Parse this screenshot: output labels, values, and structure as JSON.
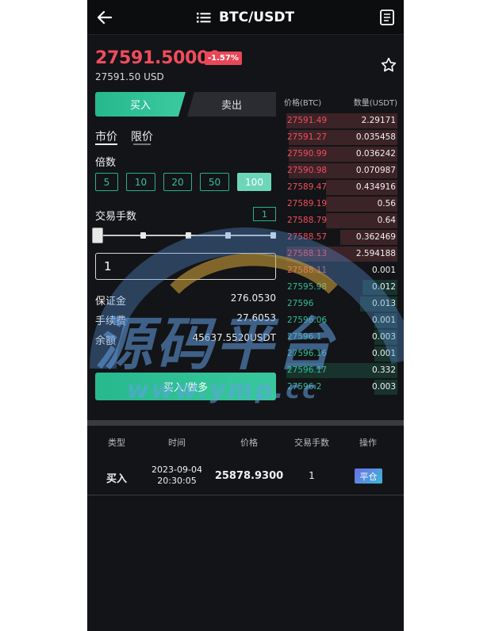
{
  "header": {
    "title": "BTC/USDT"
  },
  "ticker": {
    "price": "27591.50000",
    "change": "-1.57%",
    "usd_price": "27591.50 USD"
  },
  "trade_tabs": {
    "buy": "买入",
    "sell": "卖出"
  },
  "order_types": {
    "market": "市价",
    "limit": "限价"
  },
  "leverage": {
    "label": "倍数",
    "options": [
      "5",
      "10",
      "20",
      "50",
      "100"
    ],
    "selected": "100"
  },
  "quantity": {
    "label": "交易手数",
    "badge": "1",
    "input_value": "1",
    "slider_value_fraction": 0
  },
  "summary": {
    "margin_label": "保证金",
    "margin_value": "276.0530",
    "fee_label": "手续费",
    "fee_value": "27.6053",
    "balance_label": "余额",
    "balance_value": "45637.5520USDT"
  },
  "submit": {
    "label": "买入/做多"
  },
  "orderbook": {
    "price_header": "价格(BTC)",
    "qty_header": "数量(USDT)",
    "asks": [
      {
        "price": "27591.49",
        "qty": "2.29171",
        "depth": 0.98
      },
      {
        "price": "27591.27",
        "qty": "0.035458",
        "depth": 0.96
      },
      {
        "price": "27590.99",
        "qty": "0.036242",
        "depth": 0.96
      },
      {
        "price": "27590.98",
        "qty": "0.070987",
        "depth": 0.96
      },
      {
        "price": "27589.47",
        "qty": "0.434916",
        "depth": 0.63
      },
      {
        "price": "27589.19",
        "qty": "0.56",
        "depth": 0.63
      },
      {
        "price": "27588.79",
        "qty": "0.64",
        "depth": 0.63
      },
      {
        "price": "27588.57",
        "qty": "0.362469",
        "depth": 0.5
      },
      {
        "price": "27588.13",
        "qty": "2.594188",
        "depth": 0.98
      }
    ],
    "mid": {
      "price": "27588.11",
      "qty": "0.001"
    },
    "bids": [
      {
        "price": "27595.98",
        "qty": "0.012",
        "depth": 0.31
      },
      {
        "price": "27596",
        "qty": "0.013",
        "depth": 0.33
      },
      {
        "price": "27596.06",
        "qty": "0.001",
        "depth": 0.2
      },
      {
        "price": "27596.1",
        "qty": "0.003",
        "depth": 0.2
      },
      {
        "price": "27596.16",
        "qty": "0.001",
        "depth": 0.2
      },
      {
        "price": "27596.17",
        "qty": "0.332",
        "depth": 0.98
      },
      {
        "price": "27596.2",
        "qty": "0.003",
        "depth": 0.2
      }
    ]
  },
  "watermark": {
    "text": "源码平台",
    "url": "www.ymp.cc"
  },
  "orders": {
    "headers": [
      "类型",
      "时间",
      "价格",
      "交易手数",
      "操作"
    ],
    "rows": [
      {
        "type": "买入",
        "date": "2023-09-04",
        "time": "20:30:05",
        "price": "25878.9300",
        "qty": "1",
        "action": "平仓"
      }
    ]
  },
  "colors": {
    "ask": "#f04d5d",
    "bid": "#2fbf95",
    "accent": "#27b98d",
    "background": "#131417"
  }
}
